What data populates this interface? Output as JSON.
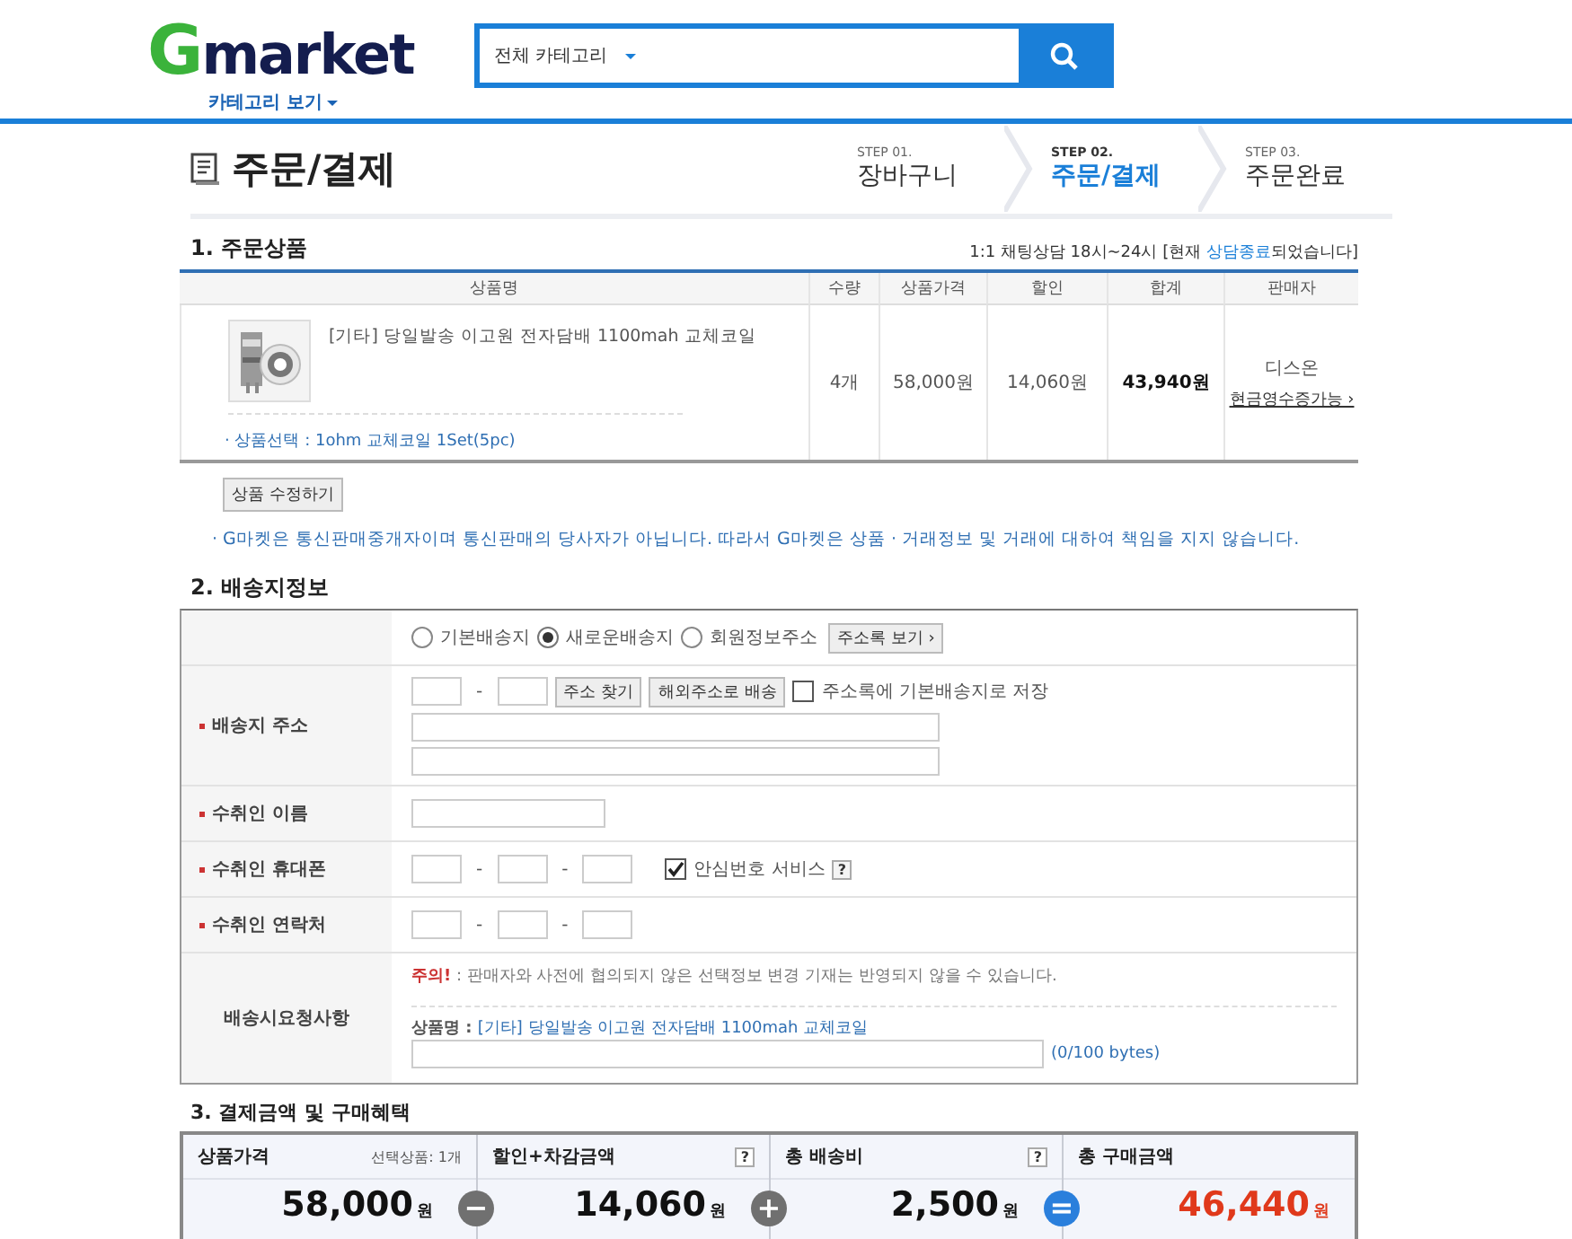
{
  "header": {
    "logo": {
      "letter": "G",
      "word": "market"
    },
    "category_link": "카테고리 보기",
    "search": {
      "category": "전체 카테고리"
    }
  },
  "page": {
    "title": "주문/결제",
    "steps": [
      {
        "step": "STEP 01.",
        "label": "장바구니",
        "selected": false
      },
      {
        "step": "STEP 02.",
        "label": "주문/결제",
        "selected": true
      },
      {
        "step": "STEP 03.",
        "label": "주문완료",
        "selected": false
      }
    ]
  },
  "order": {
    "heading": "1. 주문상품",
    "chat_notice": {
      "prefix": "1:1 채팅상담 18시~24시 [현재 ",
      "status": "상담종료",
      "suffix": "되었습니다]"
    },
    "columns": [
      "상품명",
      "수량",
      "상품가격",
      "할인",
      "합계",
      "판매자"
    ],
    "rows": [
      {
        "product": "[기타] 당일발송 이고원 전자담배 1100mah 교체코일",
        "option": "· 상품선택 : 1ohm 교체코일 1Set(5pc)",
        "quantity": "4개",
        "price": "58,000원",
        "discount": "14,060원",
        "total": "43,940원",
        "seller": "디스온",
        "receipt_link": "현금영수증가능 ›"
      }
    ],
    "edit_button": "상품 수정하기",
    "notice": "· G마켓은 통신판매중개자이며 통신판매의 당사자가 아닙니다. 따라서 G마켓은 상품 · 거래정보 및 거래에 대하여 책임을 지지 않습니다."
  },
  "shipping": {
    "heading": "2. 배송지정보",
    "address_options": [
      {
        "label": "기본배송지",
        "selected": false
      },
      {
        "label": "새로운배송지",
        "selected": true
      },
      {
        "label": "회원정보주소",
        "selected": false
      }
    ],
    "address_book_button": "주소록 보기 ›",
    "address_label": "배송지 주소",
    "find_button": "주소 찾기",
    "overseas_button": "해외주소로 배송",
    "save_default": {
      "label": "주소록에 기본배송지로 저장",
      "checked": false
    },
    "separator": "-",
    "name_label": "수취인 이름",
    "mobile_label": "수취인 휴대폰",
    "safe_number": {
      "label": "안심번호 서비스",
      "checked": true,
      "help": "?"
    },
    "phone_label": "수취인 연락처",
    "request_label": "배송시요청사항",
    "caution": {
      "title": "주의!",
      "text": " : 판매자와 사전에 협의되지 않은 선택정보 변경 기재는 반영되지 않을 수 있습니다."
    },
    "product_label": "상품명 : ",
    "product_name": "[기타] 당일발송 이고원 전자담배 1100mah 교체코일",
    "byte_count": "(0/100 bytes)"
  },
  "payment": {
    "heading": "3. 결제금액 및 구매혜택",
    "cells": [
      {
        "title": "상품가격",
        "note": "선택상품: 1개",
        "amount": "58,000",
        "unit": "원",
        "operator": "−",
        "color": "#707070",
        "highlight": false
      },
      {
        "title": "할인+차감금액",
        "help": "?",
        "amount": "14,060",
        "unit": "원",
        "operator": "+",
        "color": "#707070",
        "highlight": false
      },
      {
        "title": "총 배송비",
        "help": "?",
        "amount": "2,500",
        "unit": "원",
        "operator": "=",
        "color": "#2a7fdc",
        "highlight": false
      },
      {
        "title": "총 구매금액",
        "amount": "46,440",
        "unit": "원",
        "highlight": true
      }
    ]
  }
}
